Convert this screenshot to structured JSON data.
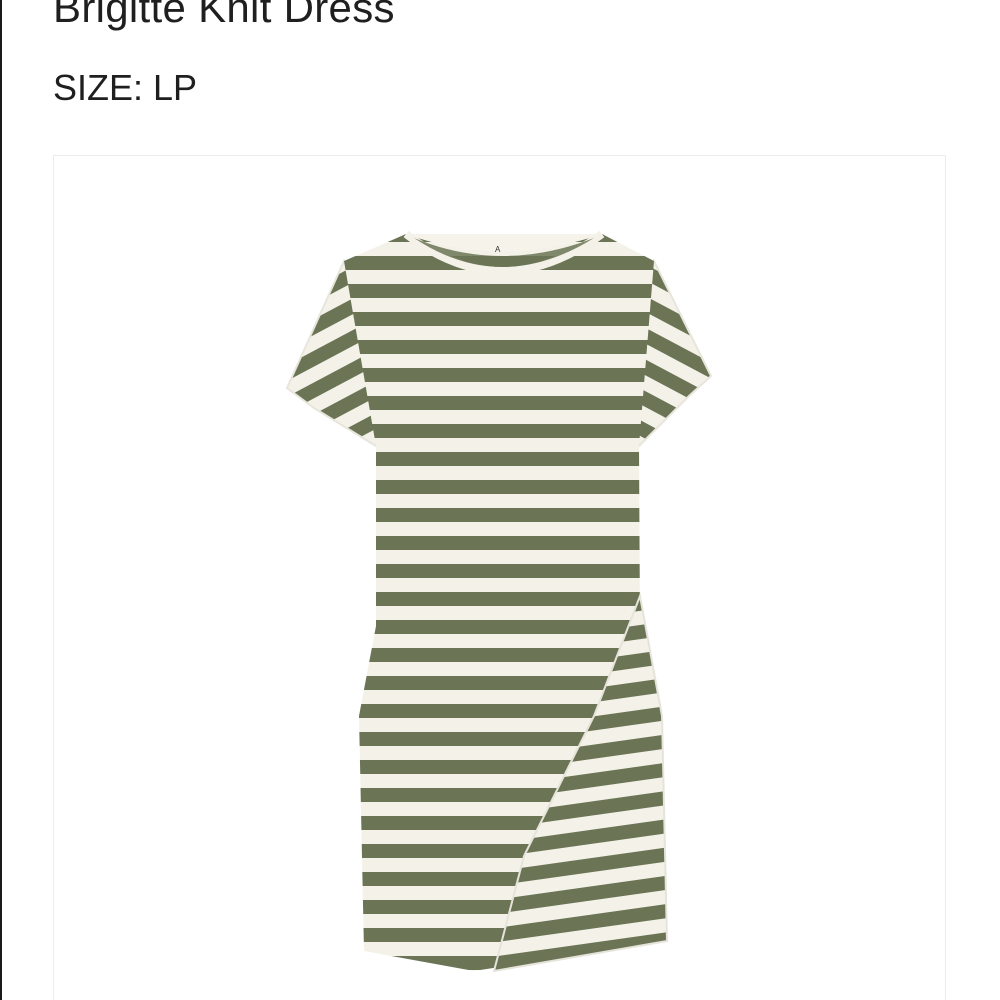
{
  "product": {
    "title": "Brigitte Knit Dress",
    "size_label": "SIZE: LP"
  },
  "image": {
    "stripe_colors": {
      "olive": "#6b7556",
      "cream": "#f4f2e8"
    }
  }
}
